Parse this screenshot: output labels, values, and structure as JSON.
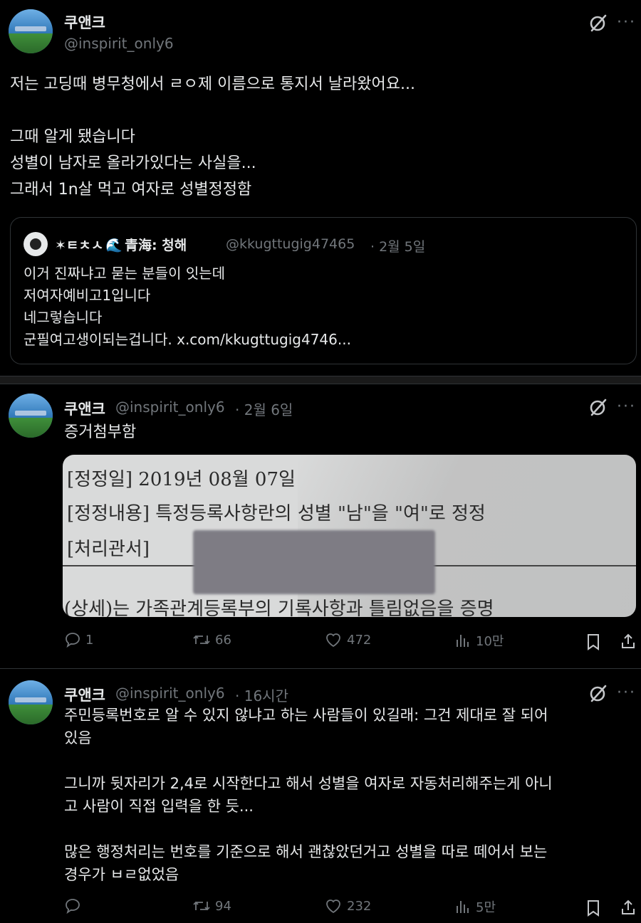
{
  "tweet1": {
    "name": "쿠앤크",
    "handle": "@inspirit_only6",
    "text": "저는 고딩때 병무청에서 ㄹㅇ제 이름으로 통지서 날라왔어요...\n\n그때 알게 됐습니다\n성별이 남자로 올라가있다는 사실을...\n그래서 1n살 먹고 여자로 성별정정함",
    "quote": {
      "name_prefix": "✶ㅌㅊㅅ",
      "name_main": "青海: 청해",
      "handle": "@kkugttugig47465",
      "date": "· 2월 5일",
      "text": "이거 진짜냐고 묻는 분들이 잇는데\n저여자예비고1입니다\n네그렇습니다\n군필여고생이되는겁니다. x.com/kkugttugig4746..."
    }
  },
  "tweet2": {
    "name": "쿠앤크",
    "handle": "@inspirit_only6",
    "date": "· 2월 6일",
    "text": "증거첨부함",
    "image": {
      "line1": "[정정일]    2019년 08월 07일",
      "line2": "[정정내용]    특정등록사항란의 성별 \"남\"을 \"여\"로 정정",
      "line3": "[처리관서]",
      "line4": "(상세)는 가족관계등록부의 기록사항과 틀림없음을 증명"
    },
    "stats": {
      "replies": "1",
      "retweets": "66",
      "likes": "472",
      "views": "10만"
    }
  },
  "tweet3": {
    "name": "쿠앤크",
    "handle": "@inspirit_only6",
    "date": "· 16시간",
    "text": "주민등록번호로 알 수 있지 않냐고 하는 사람들이 있길래: 그건 제대로 잘 되어\n있음\n\n그니까 뒷자리가 2,4로 시작한다고 해서 성별을 여자로 자동처리해주는게 아니\n고 사람이 직접 입력을 한 듯...\n\n많은 행정처리는 번호를 기준으로 해서 괜찮았던거고 성별을 따로 떼어서 보는\n경우가 ㅂㄹ없었음",
    "stats": {
      "replies": "",
      "retweets": "94",
      "likes": "232",
      "views": "5만"
    }
  }
}
